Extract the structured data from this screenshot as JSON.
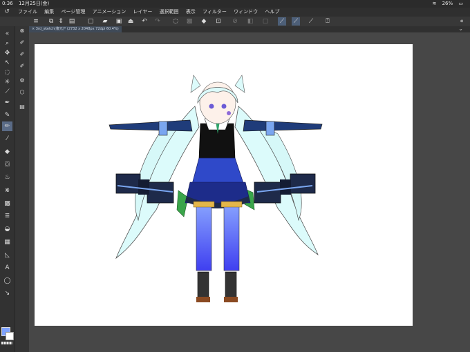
{
  "status_bar": {
    "time": "0:36",
    "date": "12月25日(金)",
    "wifi_icon": "wifi-icon",
    "battery": "26%"
  },
  "menu": {
    "logo_icon": "clip-studio-logo-icon",
    "items": [
      "ファイル",
      "編集",
      "ページ管理",
      "アニメーション",
      "レイヤー",
      "選択範囲",
      "表示",
      "フィルター",
      "ウィンドウ",
      "ヘルプ"
    ]
  },
  "tab": {
    "title": "3rd_sketch(復元)* (2732 x 2048px 72dpi 60.4%)"
  },
  "colors": {
    "accent": "#5a6b86",
    "canvas": "#ffffff",
    "foreground": "#7ea2ff",
    "background_color": "#ffffff",
    "hair": "#dcfbfb",
    "dress_blue": "#2f49c9",
    "dark_navy": "#1e2a4a"
  }
}
